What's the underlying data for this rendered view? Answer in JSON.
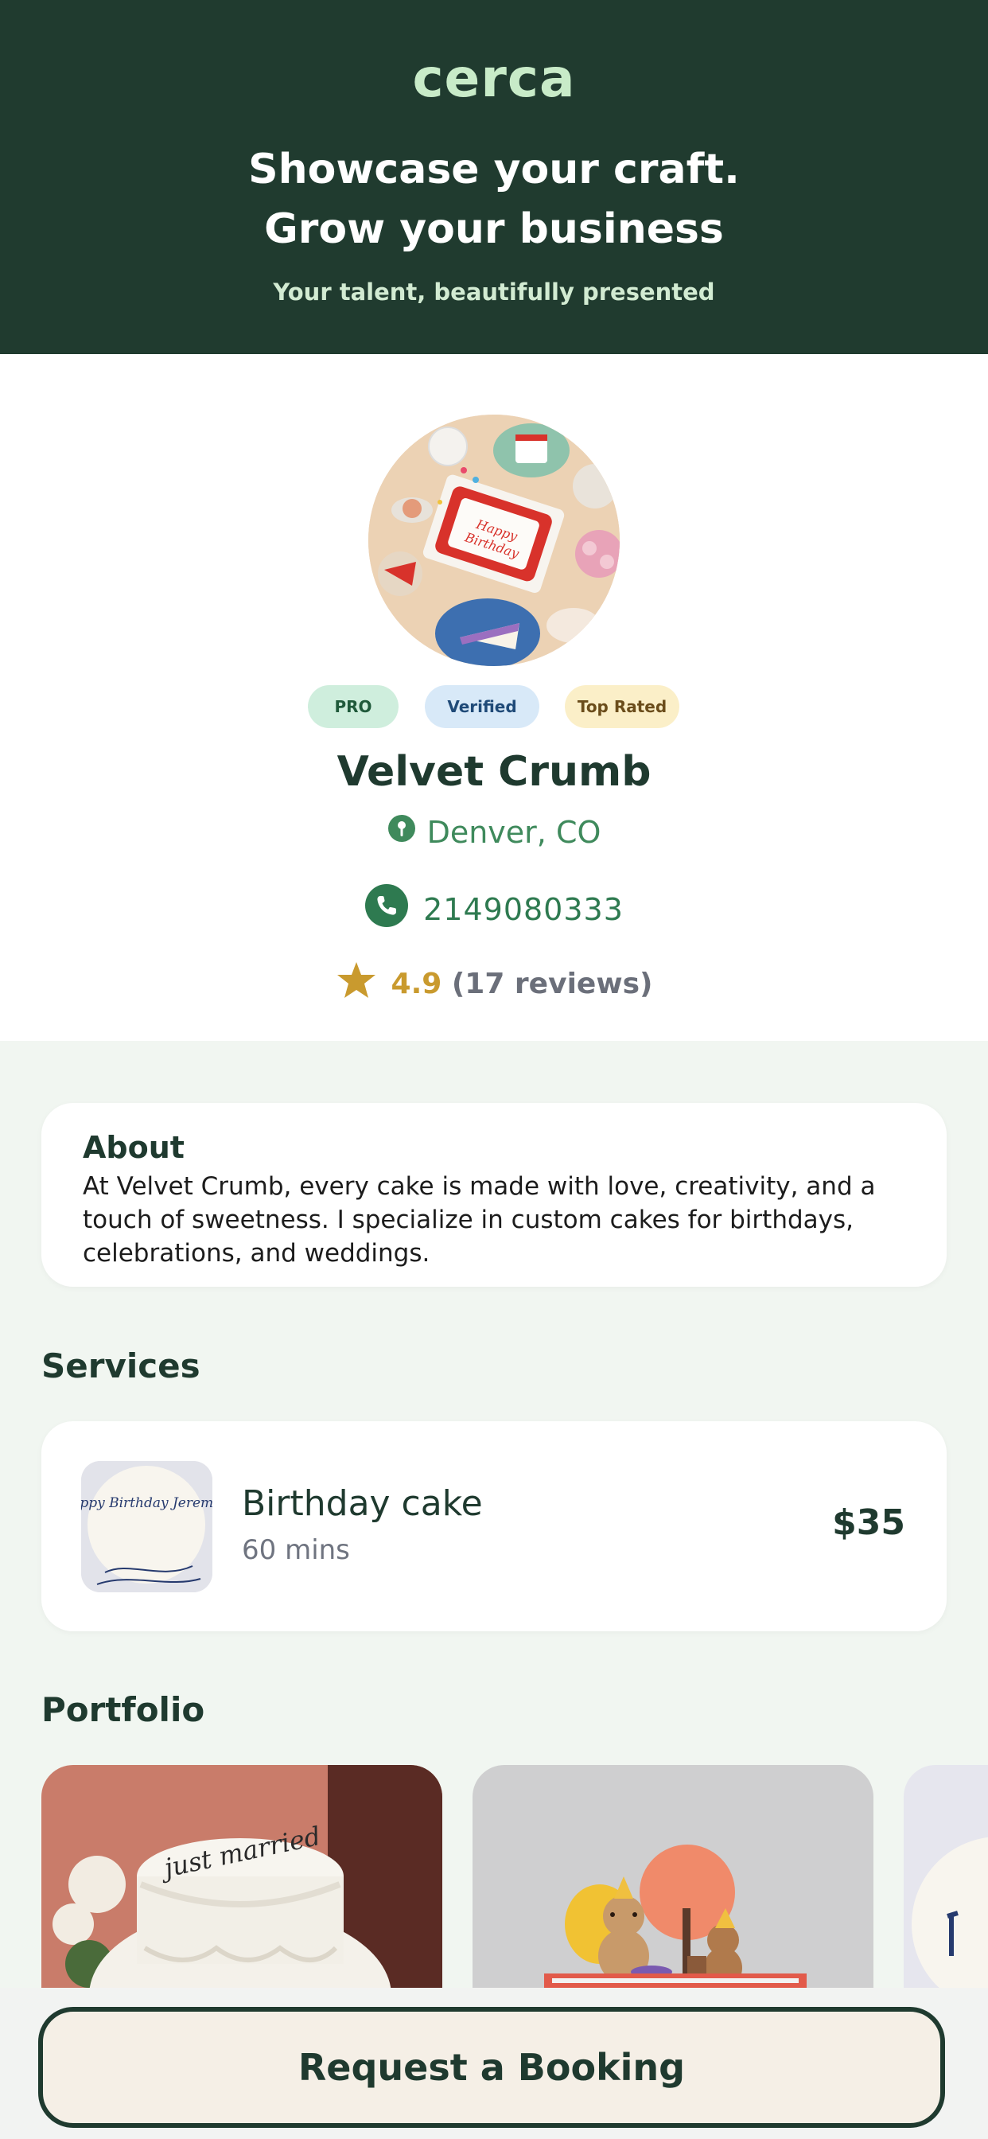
{
  "header": {
    "logo": "cerca",
    "headline_line1": "Showcase your craft.",
    "headline_line2": "Grow your business",
    "tagline": "Your talent, beautifully presented"
  },
  "profile": {
    "badges": [
      "PRO",
      "Verified",
      "Top Rated"
    ],
    "name": "Velvet Crumb",
    "location": "Denver, CO",
    "phone": "2149080333",
    "rating": "4.9",
    "reviews": "(17 reviews)"
  },
  "about": {
    "title": "About",
    "text": "At Velvet Crumb, every cake is made with love, creativity, and a touch of sweetness. I specialize in custom cakes for birthdays, celebrations, and weddings."
  },
  "services": {
    "title": "Services",
    "items": [
      {
        "name": "Birthday cake",
        "duration": "60 mins",
        "price": "$35",
        "thumb_text": "Happy Birthday Jeremy!"
      }
    ]
  },
  "portfolio": {
    "title": "Portfolio",
    "cake_text": "just married"
  },
  "footer": {
    "cta": "Request a Booking"
  },
  "colors": {
    "header_bg": "#203b2f",
    "logo": "#c8ebc8",
    "accent_green": "#3f8a5c",
    "star": "#c99a2e",
    "page_bg": "#f1f6f1"
  },
  "icons": [
    "location-pin-icon",
    "phone-icon",
    "star-icon"
  ]
}
